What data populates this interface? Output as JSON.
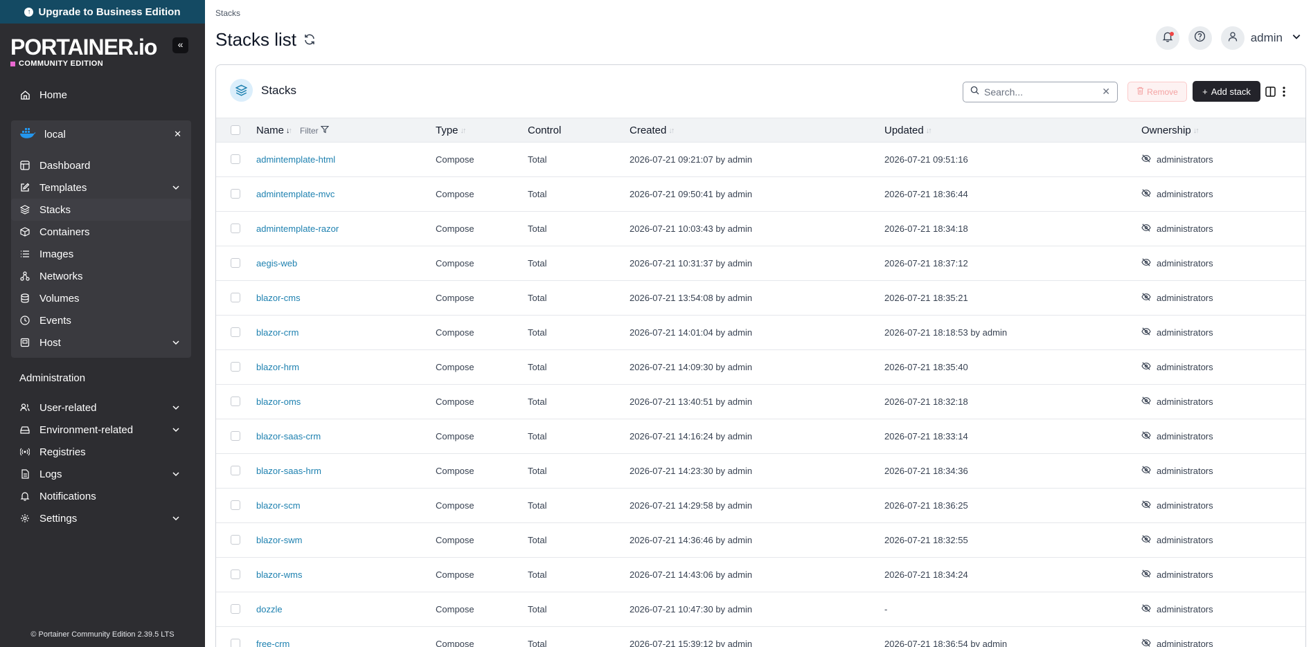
{
  "sidebar": {
    "upgrade_label": "Upgrade to Business Edition",
    "logo": "PORTAINER.io",
    "edition": "COMMUNITY EDITION",
    "home": "Home",
    "env_name": "local",
    "env_items": [
      "Dashboard",
      "Templates",
      "Stacks",
      "Containers",
      "Images",
      "Networks",
      "Volumes",
      "Events",
      "Host"
    ],
    "admin_title": "Administration",
    "admin_items": [
      "User-related",
      "Environment-related",
      "Registries",
      "Logs",
      "Notifications",
      "Settings"
    ],
    "footer": "© Portainer Community Edition 2.39.5 LTS"
  },
  "header": {
    "breadcrumb": "Stacks",
    "title": "Stacks list",
    "user": "admin"
  },
  "panel": {
    "title": "Stacks",
    "search_placeholder": "Search...",
    "remove_label": "Remove",
    "add_label": "Add stack",
    "columns": {
      "name": "Name",
      "filter": "Filter",
      "type": "Type",
      "control": "Control",
      "created": "Created",
      "updated": "Updated",
      "ownership": "Ownership"
    }
  },
  "rows": [
    {
      "name": "admintemplate-html",
      "type": "Compose",
      "control": "Total",
      "created": "2026-07-21 09:21:07 by admin",
      "updated": "2026-07-21 09:51:16",
      "ownership": "administrators"
    },
    {
      "name": "admintemplate-mvc",
      "type": "Compose",
      "control": "Total",
      "created": "2026-07-21 09:50:41 by admin",
      "updated": "2026-07-21 18:36:44",
      "ownership": "administrators"
    },
    {
      "name": "admintemplate-razor",
      "type": "Compose",
      "control": "Total",
      "created": "2026-07-21 10:03:43 by admin",
      "updated": "2026-07-21 18:34:18",
      "ownership": "administrators"
    },
    {
      "name": "aegis-web",
      "type": "Compose",
      "control": "Total",
      "created": "2026-07-21 10:31:37 by admin",
      "updated": "2026-07-21 18:37:12",
      "ownership": "administrators"
    },
    {
      "name": "blazor-cms",
      "type": "Compose",
      "control": "Total",
      "created": "2026-07-21 13:54:08 by admin",
      "updated": "2026-07-21 18:35:21",
      "ownership": "administrators"
    },
    {
      "name": "blazor-crm",
      "type": "Compose",
      "control": "Total",
      "created": "2026-07-21 14:01:04 by admin",
      "updated": "2026-07-21 18:18:53 by admin",
      "ownership": "administrators"
    },
    {
      "name": "blazor-hrm",
      "type": "Compose",
      "control": "Total",
      "created": "2026-07-21 14:09:30 by admin",
      "updated": "2026-07-21 18:35:40",
      "ownership": "administrators"
    },
    {
      "name": "blazor-oms",
      "type": "Compose",
      "control": "Total",
      "created": "2026-07-21 13:40:51 by admin",
      "updated": "2026-07-21 18:32:18",
      "ownership": "administrators"
    },
    {
      "name": "blazor-saas-crm",
      "type": "Compose",
      "control": "Total",
      "created": "2026-07-21 14:16:24 by admin",
      "updated": "2026-07-21 18:33:14",
      "ownership": "administrators"
    },
    {
      "name": "blazor-saas-hrm",
      "type": "Compose",
      "control": "Total",
      "created": "2026-07-21 14:23:30 by admin",
      "updated": "2026-07-21 18:34:36",
      "ownership": "administrators"
    },
    {
      "name": "blazor-scm",
      "type": "Compose",
      "control": "Total",
      "created": "2026-07-21 14:29:58 by admin",
      "updated": "2026-07-21 18:36:25",
      "ownership": "administrators"
    },
    {
      "name": "blazor-swm",
      "type": "Compose",
      "control": "Total",
      "created": "2026-07-21 14:36:46 by admin",
      "updated": "2026-07-21 18:32:55",
      "ownership": "administrators"
    },
    {
      "name": "blazor-wms",
      "type": "Compose",
      "control": "Total",
      "created": "2026-07-21 14:43:06 by admin",
      "updated": "2026-07-21 18:34:24",
      "ownership": "administrators"
    },
    {
      "name": "dozzle",
      "type": "Compose",
      "control": "Total",
      "created": "2026-07-21 10:47:30 by admin",
      "updated": "-",
      "ownership": "administrators"
    },
    {
      "name": "free-crm",
      "type": "Compose",
      "control": "Total",
      "created": "2026-07-21 15:39:12 by admin",
      "updated": "2026-07-21 18:36:54 by admin",
      "ownership": "administrators"
    }
  ]
}
